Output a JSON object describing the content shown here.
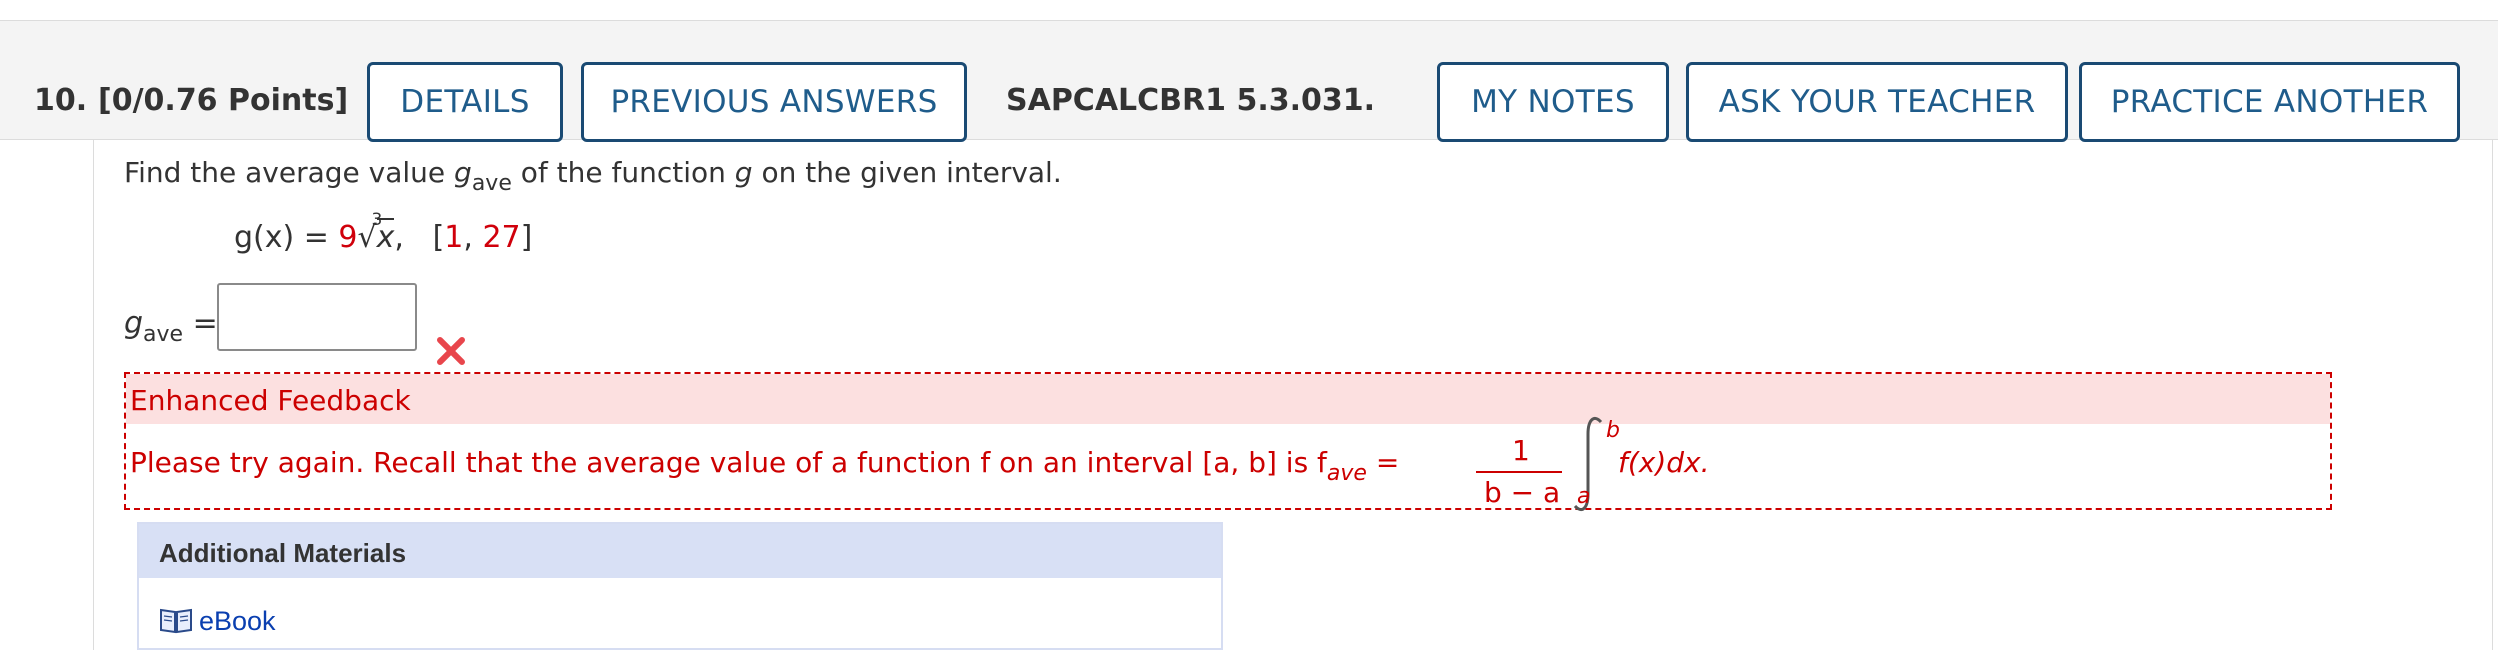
{
  "header": {
    "question_number": "10.",
    "points": "[0/0.76 Points]",
    "details_label": "DETAILS",
    "previous_answers_label": "PREVIOUS ANSWERS",
    "problem_code": "SAPCALCBR1 5.3.031.",
    "my_notes_label": "MY NOTES",
    "ask_teacher_label": "ASK YOUR TEACHER",
    "practice_another_label": "PRACTICE ANOTHER"
  },
  "question": {
    "text_before": "Find the average value ",
    "var_g": "g",
    "var_sub": "ave",
    "text_after": " of the function ",
    "var_g2": "g",
    "text_end": " on the given interval.",
    "formula": {
      "lhs": "g(x) = ",
      "coeff": "9",
      "root_index": "3",
      "radicand": "x",
      "comma": ",",
      "interval_open": "[",
      "interval_a": "1",
      "interval_sep": ", ",
      "interval_b": "27",
      "interval_close": "]"
    }
  },
  "answer": {
    "label_var": "g",
    "label_sub": "ave",
    "label_eq": " =",
    "value": "",
    "status": "incorrect"
  },
  "feedback": {
    "title": "Enhanced Feedback",
    "text": "Please try again. Recall that the average value of a function f on an interval  [a, b]  is  f",
    "text_sub": "ave",
    "text_eq": " =",
    "frac_num": "1",
    "frac_den": "b − a",
    "int_upper": "b",
    "int_lower": "a",
    "integrand": "f(x)dx."
  },
  "materials": {
    "title": "Additional Materials",
    "ebook_label": "eBook"
  },
  "colors": {
    "button_border": "#1a4a73",
    "button_text": "#1f5c8b",
    "error_red": "#cc0000",
    "feedback_bg": "#fce0e0",
    "materials_bg": "#d8e0f5",
    "link_blue": "#0a3fb0"
  }
}
